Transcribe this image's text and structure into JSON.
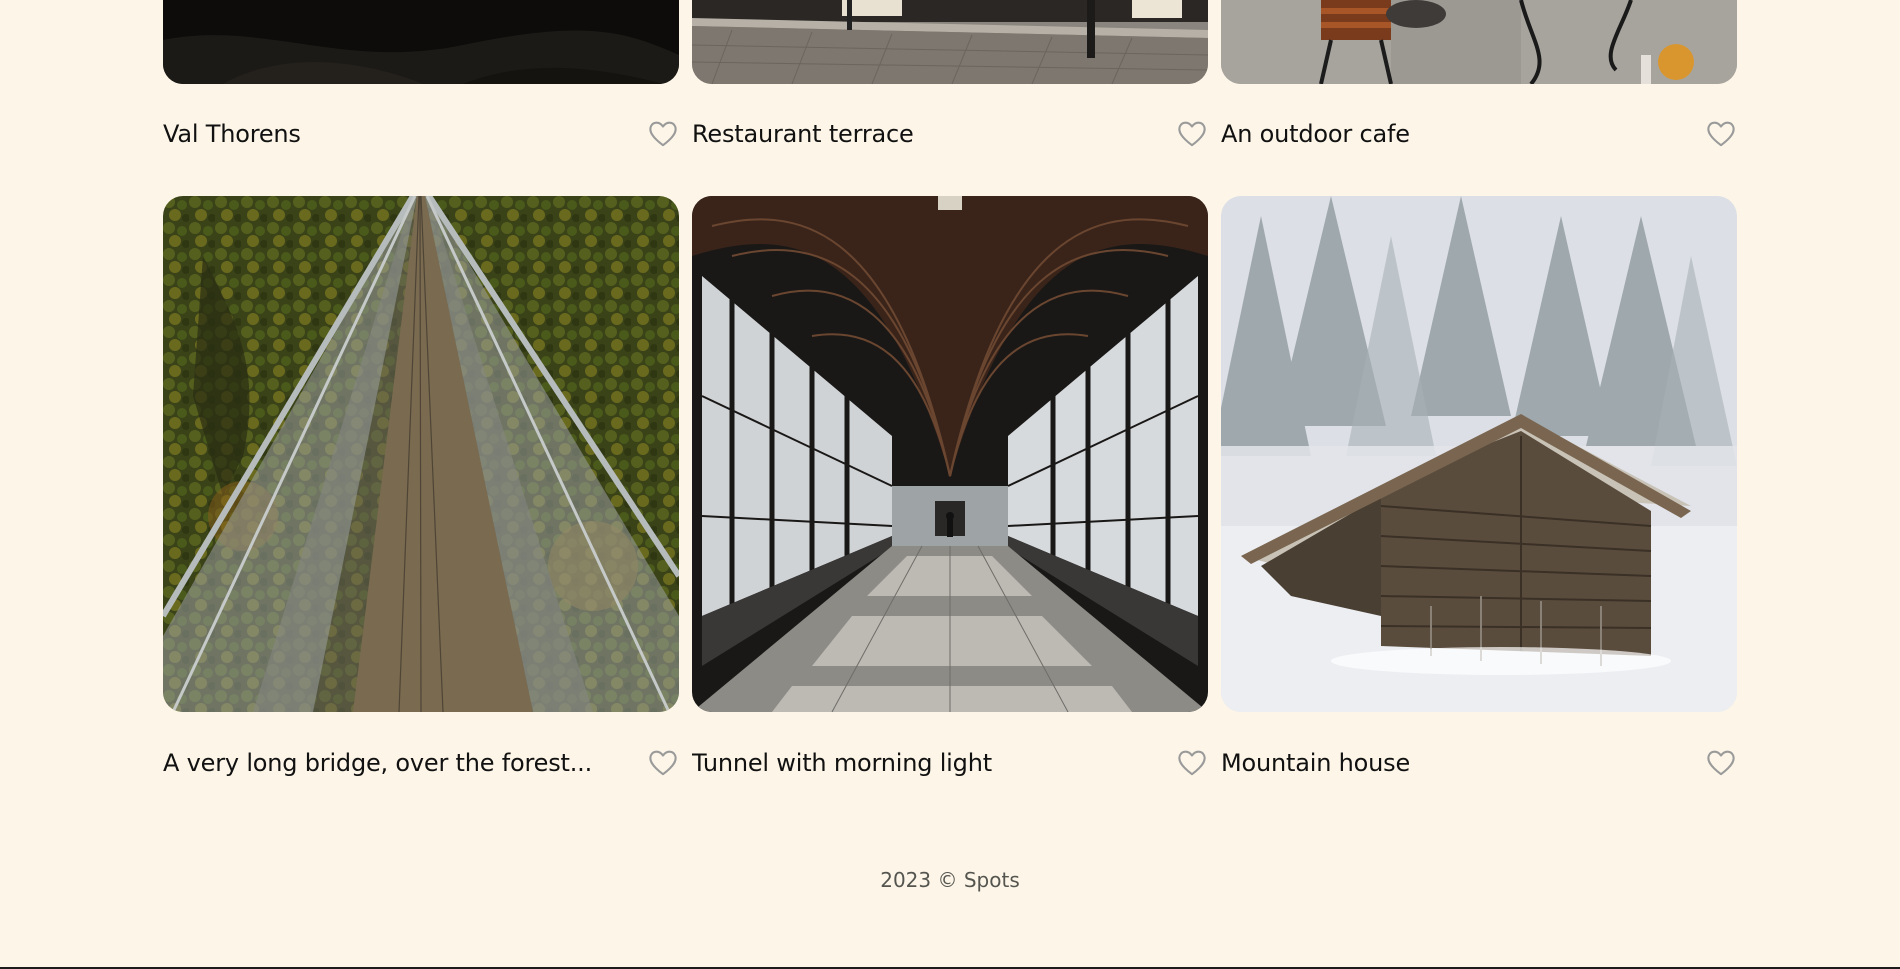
{
  "cards": [
    {
      "title": "Val Thorens",
      "liked": false
    },
    {
      "title": "Restaurant terrace",
      "liked": false
    },
    {
      "title": "An outdoor cafe",
      "liked": false
    },
    {
      "title": "A very long bridge, over the forest...",
      "liked": false
    },
    {
      "title": "Tunnel with morning light",
      "liked": false
    },
    {
      "title": "Mountain house",
      "liked": false
    }
  ],
  "footer": {
    "text": "2023 © Spots"
  },
  "colors": {
    "background": "#fdf6e8",
    "text": "#111111",
    "heart_outline": "#9a9a9a",
    "footer_text": "#555550"
  },
  "icons": {
    "like": "heart-outline-icon"
  }
}
